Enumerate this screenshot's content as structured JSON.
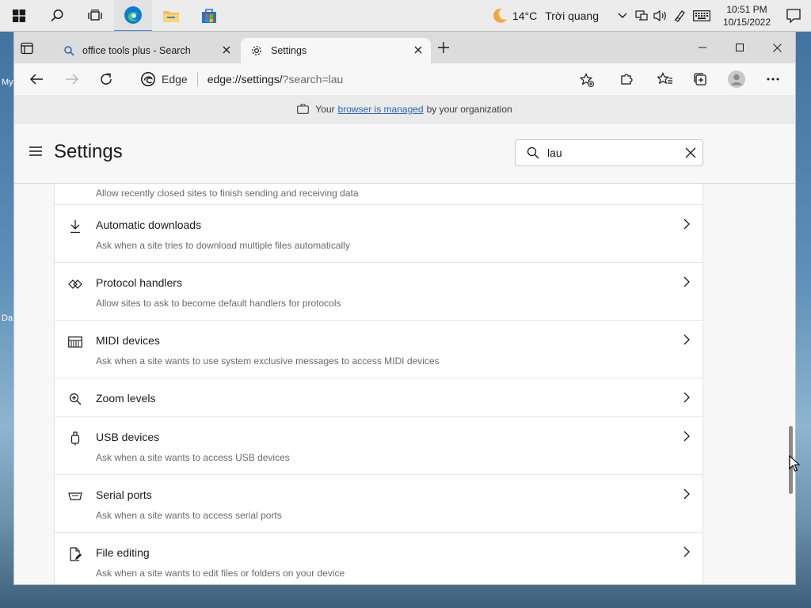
{
  "taskbar": {
    "weather": {
      "temp": "14°C",
      "condition": "Trời quang"
    },
    "clock": {
      "time": "10:51 PM",
      "date": "10/15/2022"
    }
  },
  "desktop": {
    "fragment_1": "My",
    "fragment_2": "Da"
  },
  "tabs": [
    {
      "title": "office tools plus - Search"
    },
    {
      "title": "Settings"
    }
  ],
  "toolbar": {
    "site_name": "Edge",
    "url_host": "edge://settings/",
    "url_rest": "?search=lau"
  },
  "infobar": {
    "prefix": "Your",
    "link": "browser is managed",
    "suffix": "by your organization"
  },
  "settings": {
    "title": "Settings",
    "search_value": "lau"
  },
  "items": [
    {
      "icon": "background-sync-icon",
      "title": "",
      "desc": "Allow recently closed sites to finish sending and receiving data"
    },
    {
      "icon": "download-icon",
      "title": "Automatic downloads",
      "desc": "Ask when a site tries to download multiple files automatically"
    },
    {
      "icon": "protocol-handlers-icon",
      "title": "Protocol handlers",
      "desc": "Allow sites to ask to become default handlers for protocols"
    },
    {
      "icon": "midi-icon",
      "title": "MIDI devices",
      "desc": "Ask when a site wants to use system exclusive messages to access MIDI devices"
    },
    {
      "icon": "zoom-icon",
      "title": "Zoom levels",
      "desc": ""
    },
    {
      "icon": "usb-icon",
      "title": "USB devices",
      "desc": "Ask when a site wants to access USB devices"
    },
    {
      "icon": "serial-port-icon",
      "title": "Serial ports",
      "desc": "Ask when a site wants to access serial ports"
    },
    {
      "icon": "file-edit-icon",
      "title": "File editing",
      "desc": "Ask when a site wants to edit files or folders on your device"
    }
  ],
  "colors": {
    "accent": "#2a66b5",
    "edge_blue": "#0f7bd8"
  }
}
